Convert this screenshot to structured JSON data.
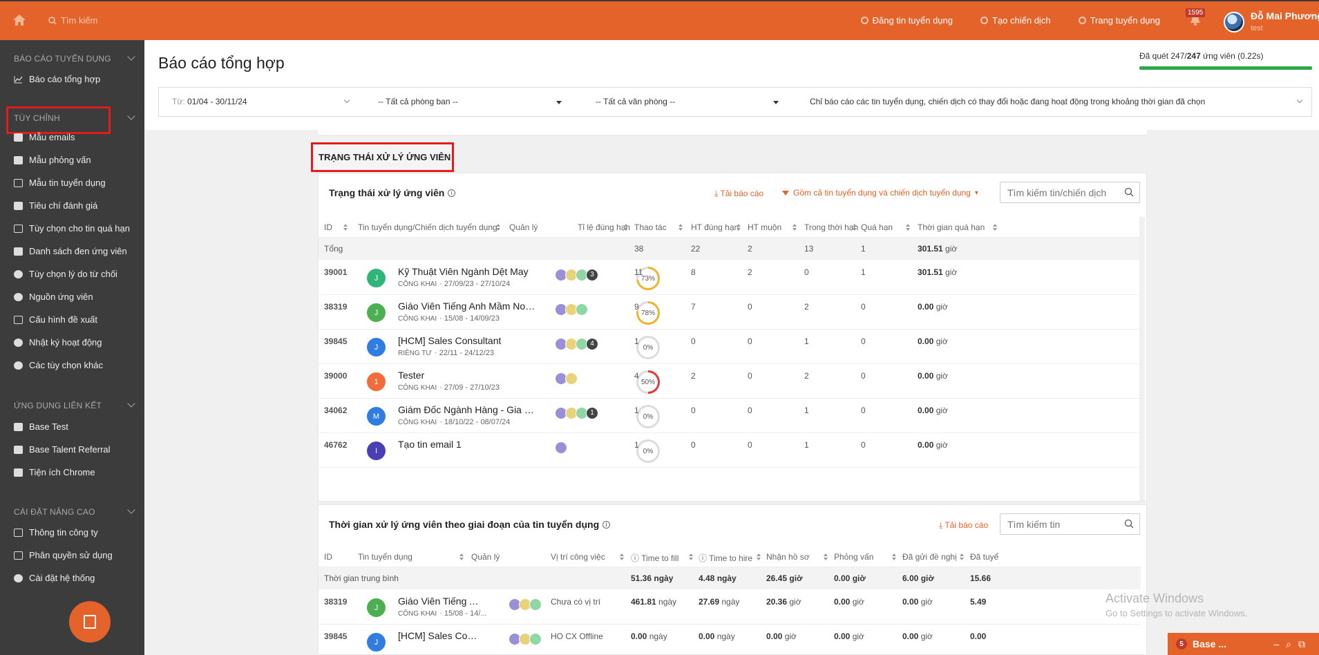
{
  "topbar": {
    "search_placeholder": "Tìm kiếm",
    "links": [
      "Đăng tin tuyển dụng",
      "Tạo chiến dịch",
      "Trang tuyển dụng"
    ],
    "notif_count": "1595",
    "user_name": "Đỗ Mai Phương",
    "user_sub": "test"
  },
  "sidebar": {
    "sections": [
      {
        "title": "BÁO CÁO TUYỂN DỤNG",
        "items": [
          "Báo cáo tổng hợp"
        ]
      },
      {
        "title": "TÙY CHỈNH",
        "items": [
          "Mẫu emails",
          "Mẫu phỏng vấn",
          "Mẫu tin tuyển dụng",
          "Tiêu chí đánh giá",
          "Tùy chọn cho tin quá hạn",
          "Danh sách đen ứng viên",
          "Tùy chọn lý do từ chối",
          "Nguồn ứng viên",
          "Cấu hình đề xuất",
          "Nhật ký hoạt động",
          "Các tùy chọn khác"
        ]
      },
      {
        "title": "ỨNG DỤNG LIÊN KẾT",
        "items": [
          "Base Test",
          "Base Talent Referral",
          "Tiện ích Chrome"
        ]
      },
      {
        "title": "CÀI ĐẶT NÂNG CAO",
        "items": [
          "Thông tin công ty",
          "Phân quyền sử dụng",
          "Cài đặt hệ thống"
        ]
      }
    ]
  },
  "header": {
    "title": "Báo cáo tổng hợp",
    "scan_prefix": "Đã quét 247/",
    "scan_bold": "247",
    "scan_suffix": " ứng viên (0.22s)",
    "scan_progress": 1.0
  },
  "filters": {
    "date_label": "Từ:",
    "date_value": "01/04 - 30/11/24",
    "department": "-- Tất cả phòng ban --",
    "office": "-- Tất cả văn phòng --",
    "scope": "Chỉ báo cáo các tin tuyển dụng, chiến dịch có thay đổi hoặc đang hoạt động trong khoảng thời gian đã chọn"
  },
  "section_label": "TRẠNG THÁI XỬ LÝ ỨNG VIÊN",
  "card1": {
    "title": "Trạng thái xử lý ứng viên",
    "download": "Tải báo cáo",
    "filter": "Gồm cả tin tuyển dụng và chiến dịch tuyển dụng",
    "search_placeholder": "Tìm kiếm tin/chiến dịch",
    "columns": [
      "ID",
      "Tin tuyển dụng/Chiến dịch tuyển dụng",
      "Quản lý",
      "Tỉ lệ đúng hạn",
      "Thao tác",
      "HT đúng hạn",
      "HT muộn",
      "Trong thời hạn",
      "Quá hạn",
      "Thời gian quá hạn"
    ],
    "total": {
      "label": "Tổng",
      "thao_tac": "38",
      "ht_dung_han": "22",
      "ht_muon": "2",
      "trong_thoi_han": "13",
      "qua_han": "1",
      "tg_qua_han": "301.51",
      "unit": "giờ"
    },
    "rows": [
      {
        "id": "39001",
        "initial": "J",
        "color": "#2fb57a",
        "title": "Kỹ Thuật Viên Ngành Dệt May",
        "vis": "CÔNG KHAI",
        "dates": "· 27/09/23 - 27/10/24",
        "extra_mgr": "3",
        "rate": "73%",
        "rate_val": 73,
        "rate_color": "#f0b429",
        "thao_tac": "11",
        "ht_dung_han": "8",
        "ht_muon": "2",
        "trong_thoi_han": "0",
        "qua_han": "1",
        "tg": "301.51",
        "unit": "giờ"
      },
      {
        "id": "38319",
        "initial": "J",
        "color": "#4caf50",
        "title": "Giáo Viên Tiếng Anh Mầm Non...",
        "vis": "CÔNG KHAI",
        "dates": "· 15/08 - 14/09/23",
        "extra_mgr": "",
        "rate": "78%",
        "rate_val": 78,
        "rate_color": "#f0b429",
        "thao_tac": "9",
        "ht_dung_han": "7",
        "ht_muon": "0",
        "trong_thoi_han": "2",
        "qua_han": "0",
        "tg": "0.00",
        "unit": "giờ"
      },
      {
        "id": "39845",
        "initial": "J",
        "color": "#2f7de1",
        "title": "[HCM] Sales Consultant",
        "vis": "RIÊNG TƯ",
        "dates": "· 22/11 - 24/12/23",
        "extra_mgr": "4",
        "rate": "0%",
        "rate_val": 0,
        "rate_color": "#dcdcdc",
        "thao_tac": "1",
        "ht_dung_han": "0",
        "ht_muon": "0",
        "trong_thoi_han": "1",
        "qua_han": "0",
        "tg": "0.00",
        "unit": "giờ"
      },
      {
        "id": "39000",
        "initial": "1",
        "color": "#f26c3b",
        "title": "Tester",
        "vis": "CÔNG KHAI",
        "dates": "· 27/09 - 27/10/23",
        "extra_mgr": "",
        "rate": "50%",
        "rate_val": 50,
        "rate_color": "#e53935",
        "thao_tac": "4",
        "ht_dung_han": "2",
        "ht_muon": "0",
        "trong_thoi_han": "2",
        "qua_han": "0",
        "tg": "0.00",
        "unit": "giờ"
      },
      {
        "id": "34062",
        "initial": "M",
        "color": "#2f7de1",
        "title": "Giám Đốc Ngành Hàng - Gia D...",
        "vis": "CÔNG KHAI",
        "dates": "· 18/10/22 - 08/07/24",
        "extra_mgr": "1",
        "rate": "0%",
        "rate_val": 0,
        "rate_color": "#dcdcdc",
        "thao_tac": "1",
        "ht_dung_han": "0",
        "ht_muon": "0",
        "trong_thoi_han": "1",
        "qua_han": "0",
        "tg": "0.00",
        "unit": "giờ"
      },
      {
        "id": "46762",
        "initial": "I",
        "color": "#4b3fb5",
        "title": "Tạo tin email 1",
        "vis": "",
        "dates": "",
        "extra_mgr": "",
        "rate": "0%",
        "rate_val": 0,
        "rate_color": "#dcdcdc",
        "thao_tac": "1",
        "ht_dung_han": "0",
        "ht_muon": "0",
        "trong_thoi_han": "1",
        "qua_han": "0",
        "tg": "0.00",
        "unit": "giờ"
      }
    ]
  },
  "card2": {
    "title": "Thời gian xử lý ứng viên theo giai đoạn của tin tuyển dụng",
    "download": "Tải báo cáo",
    "search_placeholder": "Tìm kiếm tin",
    "columns": [
      "ID",
      "Tin tuyển dụng",
      "Quản lý",
      "Vị trí công việc",
      "Time to fill",
      "Time to hire",
      "Nhận hồ sơ",
      "Phỏng vấn",
      "Đã gửi đề nghị",
      "Đã tuyể"
    ],
    "avg": {
      "label": "Thời gian trung bình",
      "ttf": "51.36 ngày",
      "tth": "4.48 ngày",
      "nhs": "26.45 giờ",
      "pv": "0.00 giờ",
      "dgdn": "6.00 giờ",
      "last": "15.66"
    },
    "rows": [
      {
        "id": "38319",
        "initial": "J",
        "color": "#4caf50",
        "title": "Giáo Viên Tiếng An...",
        "vis": "CÔNG KHAI",
        "dates": "· 15/08 - 14/...",
        "position": "Chưa có vị trí",
        "ttf": "461.81",
        "tth": "27.69",
        "nhs": "20.36",
        "pv": "0.00",
        "dgdn": "0.00",
        "last": "5.49"
      },
      {
        "id": "39845",
        "initial": "J",
        "color": "#2f7de1",
        "title": "[HCM] Sales Consul...",
        "vis": "",
        "dates": "",
        "position": "HO CX Offline",
        "ttf": "0.00",
        "tth": "0.00",
        "nhs": "0.00",
        "pv": "0.00",
        "dgdn": "0.00",
        "last": "0.00"
      }
    ]
  },
  "watermark": {
    "line1": "Activate Windows",
    "line2": "Go to Settings to activate Windows."
  },
  "chat": {
    "count": "5",
    "label": "Base ..."
  }
}
